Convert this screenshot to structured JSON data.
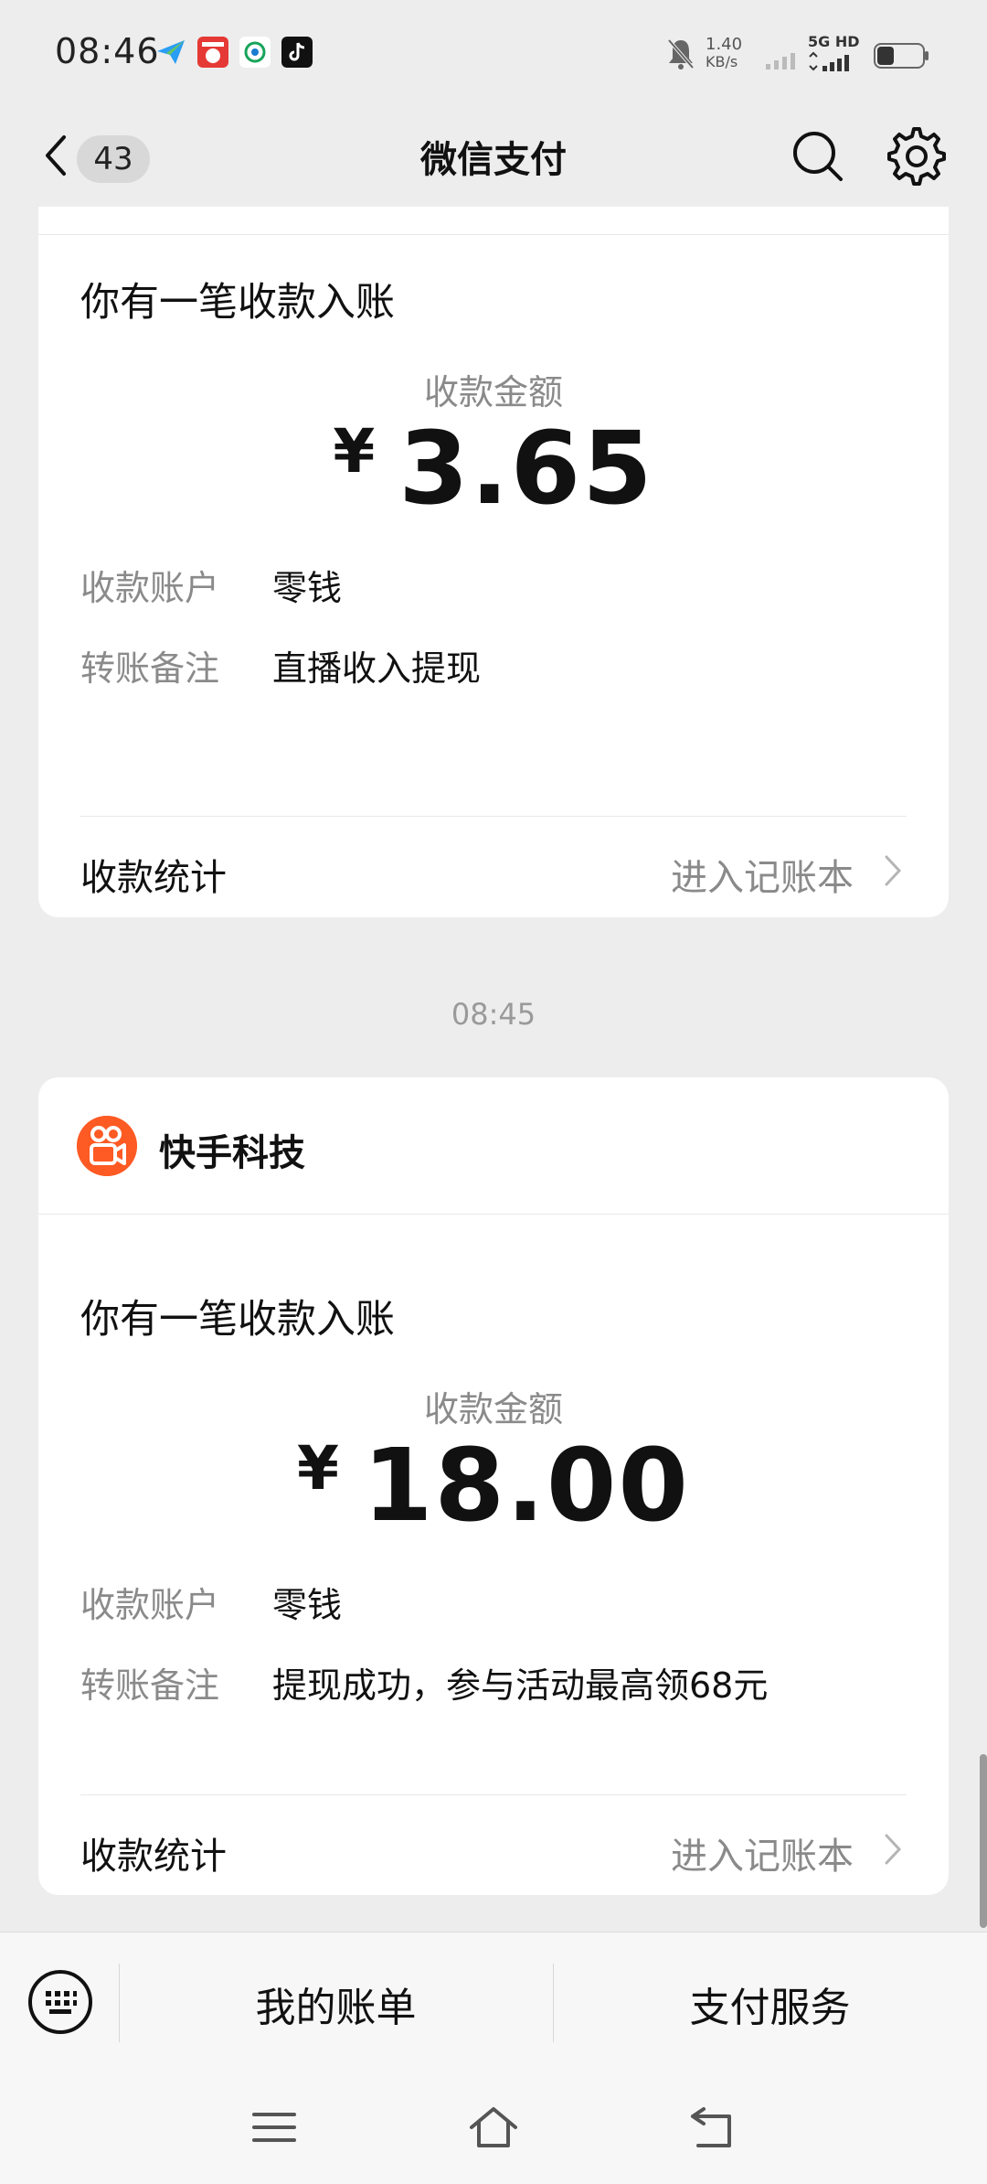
{
  "status_bar": {
    "time": "08:46",
    "net_speed_value": "1.40",
    "net_speed_unit": "KB/s",
    "network_type": "5G HD"
  },
  "nav": {
    "unread_count": "43",
    "title": "微信支付",
    "icons": [
      "back-icon",
      "search-icon",
      "gear-icon"
    ]
  },
  "messages": [
    {
      "title": "你有一笔收款入账",
      "amount_label": "收款金额",
      "currency": "¥",
      "amount": "3.65",
      "account_label": "收款账户",
      "account_value": "零钱",
      "note_label": "转账备注",
      "note_value": "直播收入提现",
      "footer_left": "收款统计",
      "footer_right": "进入记账本"
    },
    {
      "time": "08:45",
      "sender": "快手科技",
      "title": "你有一笔收款入账",
      "amount_label": "收款金额",
      "currency": "¥",
      "amount": "18.00",
      "account_label": "收款账户",
      "account_value": "零钱",
      "note_label": "转账备注",
      "note_value": "提现成功，参与活动最高领68元",
      "footer_left": "收款统计",
      "footer_right": "进入记账本"
    }
  ],
  "bottom_menu": {
    "items": [
      "我的账单",
      "支付服务"
    ]
  },
  "colors": {
    "background": "#ededed",
    "card": "#ffffff",
    "secondary_text": "#8a8a8a",
    "kuaishou_orange": "#fe5a24"
  }
}
